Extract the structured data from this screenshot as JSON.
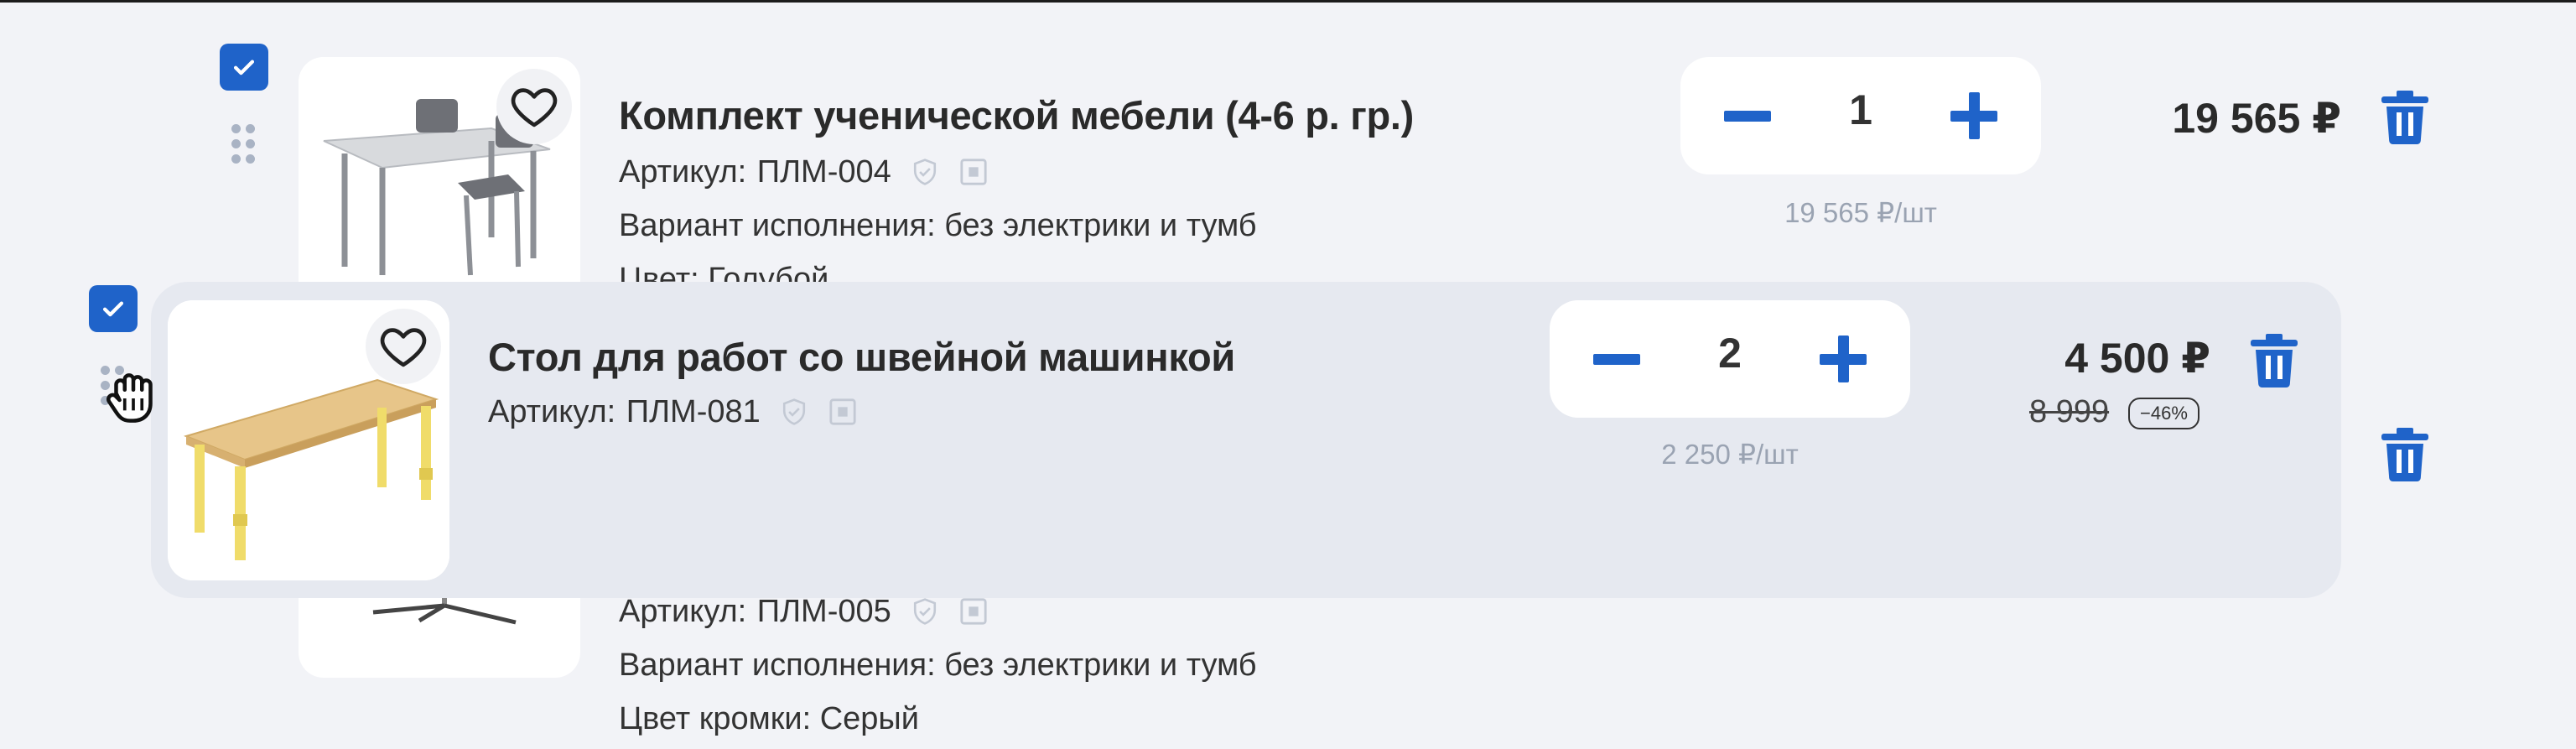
{
  "items": [
    {
      "title": "Комплект ученической мебели (4-6 р. гр.)",
      "article_label": "Артикул:",
      "article_value": "ПЛМ-004",
      "variant": "Вариант исполнения: без электрики и тумб",
      "color_partial": "Цвет: Голубой",
      "quantity": "1",
      "unit_price": "19 565 ₽/шт",
      "price": "19 565 ₽",
      "checked": true
    },
    {
      "title": "Стол для работ со швейной машинкой",
      "article_label": "Артикул:",
      "article_value": "ПЛМ-081",
      "quantity": "2",
      "unit_price": "2 250 ₽/шт",
      "price": "4 500 ₽",
      "old_price": "8 999",
      "discount": "−46%",
      "checked": true,
      "state": "dragging"
    },
    {
      "article_label": "Артикул:",
      "article_value": "ПЛМ-005",
      "variant": "Вариант исполнения: без электрики и тумб",
      "edge_color": "Цвет кромки: Серый"
    }
  ],
  "icons": {
    "check": "check-icon",
    "drag": "drag-handle-icon",
    "favorite": "heart-icon",
    "verified": "shield-check-icon",
    "certificate": "document-icon",
    "delete": "trash-icon",
    "cursor": "grab-hand-cursor-icon"
  },
  "colors": {
    "accent": "#1f63c9",
    "background": "#f2f3f7",
    "drag_card": "#e6e9f0",
    "muted_text": "#9aa3b2"
  }
}
